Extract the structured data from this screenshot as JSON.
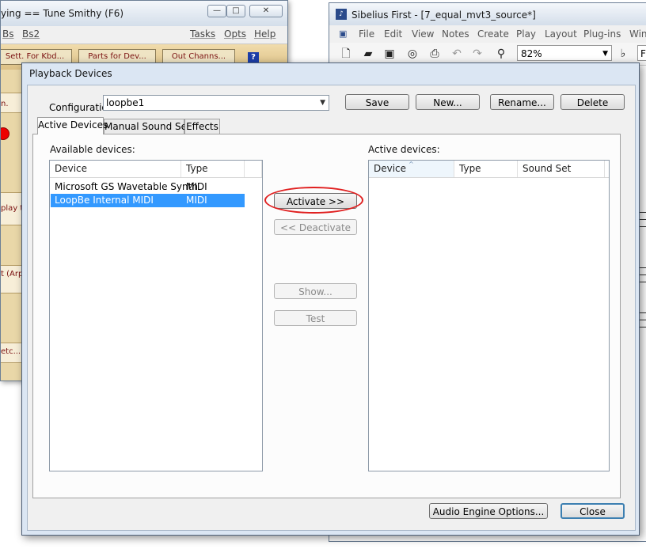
{
  "tunesmithy": {
    "title": "ying == Tune Smithy (F6)",
    "controls": [
      "—",
      "□",
      "✕"
    ],
    "menus": [
      "Bs",
      "Bs2",
      "Tasks",
      "Opts",
      "Help"
    ],
    "toolbar": [
      "Sett. For Kbd...",
      "Parts for Dev...",
      "Out Channs..."
    ],
    "help_label": "?",
    "side_texts": [
      "n.",
      "play t",
      "t (Arp",
      "etc..."
    ]
  },
  "sibelius": {
    "title": "Sibelius First - [7_equal_mvt3_source*]",
    "icon_label": "♪",
    "menus": [
      "File",
      "Edit",
      "View",
      "Notes",
      "Create",
      "Play",
      "Layout",
      "Plug-ins",
      "Win"
    ],
    "zoom": "82%",
    "toolbar_extra": "F"
  },
  "dialog": {
    "title": "Playback Devices",
    "configuration_label": "Configuration:",
    "configuration_value": "loopbe1",
    "buttons": {
      "save": "Save",
      "new": "New...",
      "rename": "Rename...",
      "delete": "Delete",
      "activate": "Activate >>",
      "deactivate": "<< Deactivate",
      "show": "Show...",
      "test": "Test",
      "audio_engine": "Audio Engine Options...",
      "close": "Close"
    },
    "tabs": [
      "Active Devices",
      "Manual Sound Sets",
      "Effects"
    ],
    "available": {
      "label": "Available devices:",
      "columns": [
        "Device",
        "Type"
      ],
      "rows": [
        {
          "device": "Microsoft GS Wavetable Synth",
          "type": "MIDI",
          "selected": false
        },
        {
          "device": "LoopBe Internal MIDI",
          "type": "MIDI",
          "selected": true
        }
      ]
    },
    "active": {
      "label": "Active devices:",
      "columns": [
        "Device",
        "Type",
        "Sound Set"
      ],
      "rows": []
    }
  }
}
